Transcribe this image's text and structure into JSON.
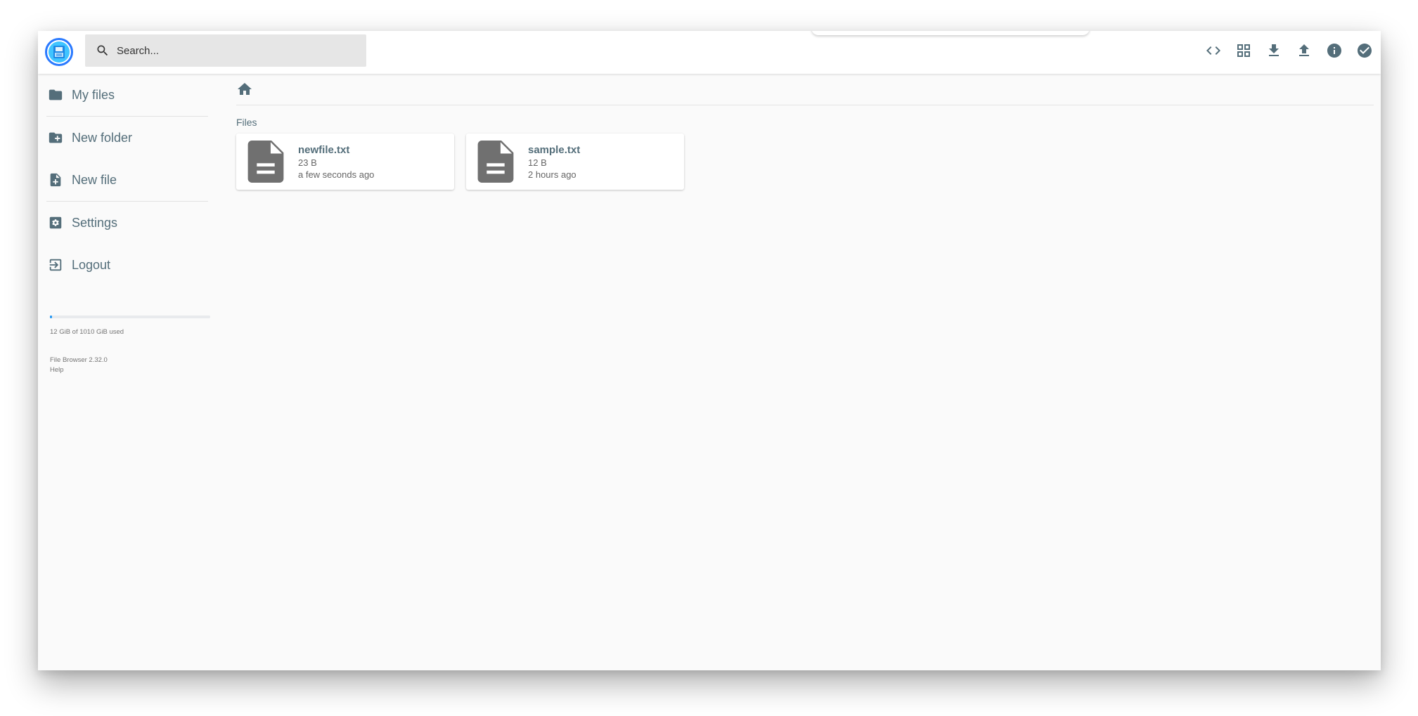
{
  "search": {
    "placeholder": "Search..."
  },
  "header": {
    "actions": [
      {
        "name": "switch-view",
        "icon": "code-icon"
      },
      {
        "name": "view-mode",
        "icon": "grid-icon"
      },
      {
        "name": "download",
        "icon": "download-icon"
      },
      {
        "name": "upload",
        "icon": "upload-icon"
      },
      {
        "name": "info",
        "icon": "info-icon"
      },
      {
        "name": "select",
        "icon": "check-circle-icon"
      }
    ]
  },
  "sidebar": {
    "items": [
      {
        "label": "My files",
        "icon": "folder-icon"
      },
      {
        "label": "New folder",
        "icon": "create-new-folder-icon"
      },
      {
        "label": "New file",
        "icon": "note-add-icon"
      },
      {
        "label": "Settings",
        "icon": "settings-icon"
      },
      {
        "label": "Logout",
        "icon": "exit-icon"
      }
    ],
    "usage": {
      "text": "12 GiB of 1010 GiB used",
      "fraction": 0.012
    },
    "credits": {
      "version": "File Browser 2.32.0",
      "help": "Help"
    }
  },
  "main": {
    "section_title": "Files",
    "files": [
      {
        "name": "newfile.txt",
        "size": "23 B",
        "modified": "a few seconds ago"
      },
      {
        "name": "sample.txt",
        "size": "12 B",
        "modified": "2 hours ago"
      }
    ]
  },
  "colors": {
    "accent": "#2196f3",
    "icon": "#546e7a",
    "file_icon": "#707070"
  }
}
